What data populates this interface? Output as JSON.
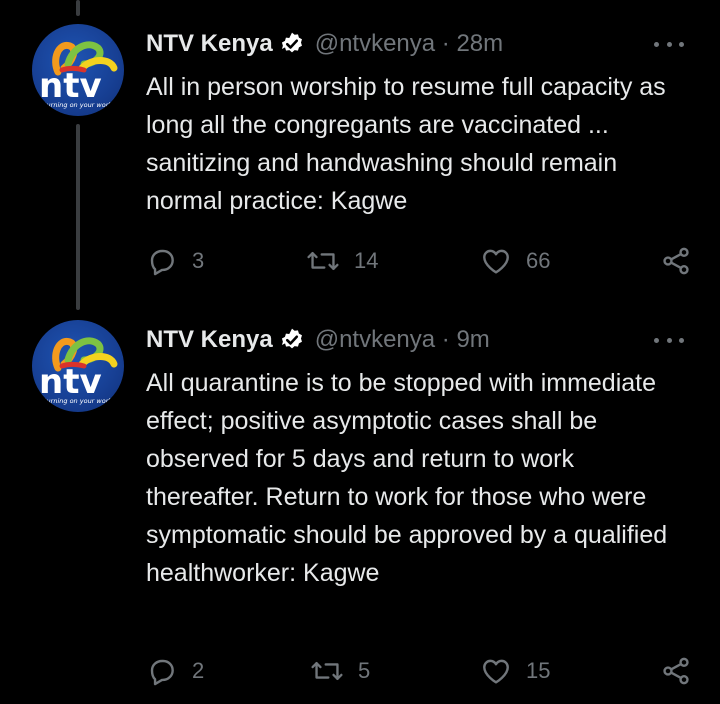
{
  "colors": {
    "background": "#000000",
    "text": "#e7e9ea",
    "muted": "#71767b",
    "verified": "#ffffff",
    "thread_line": "#3a3d40",
    "avatar_blue": "#1a4aa6"
  },
  "tweets": [
    {
      "author": {
        "name": "NTV Kenya",
        "handle": "@ntvkenya",
        "verified": true,
        "avatar_logo": "ntv",
        "avatar_tagline": "turning on your world"
      },
      "meta": "@ntvkenya · 28m",
      "text": "All in person worship to resume full capacity as long all the congregants are vaccinated ... sanitizing and handwashing should remain normal practice: Kagwe",
      "replies": "3",
      "retweets": "14",
      "likes": "66",
      "icons": [
        "reply-icon",
        "retweet-icon",
        "like-icon",
        "share-icon",
        "more-icon",
        "verified-icon"
      ]
    },
    {
      "author": {
        "name": "NTV Kenya",
        "handle": "@ntvkenya",
        "verified": true,
        "avatar_logo": "ntv",
        "avatar_tagline": "turning on your world"
      },
      "meta": "@ntvkenya · 9m",
      "text": "All quarantine is to be stopped with immediate effect; positive asymptotic cases shall be observed for 5 days and return to work thereafter. Return to work for those who were symptomatic should be approved by a qualified healthworker: Kagwe",
      "replies": "2",
      "retweets": "5",
      "likes": "15",
      "icons": [
        "reply-icon",
        "retweet-icon",
        "like-icon",
        "share-icon",
        "more-icon",
        "verified-icon"
      ]
    }
  ]
}
